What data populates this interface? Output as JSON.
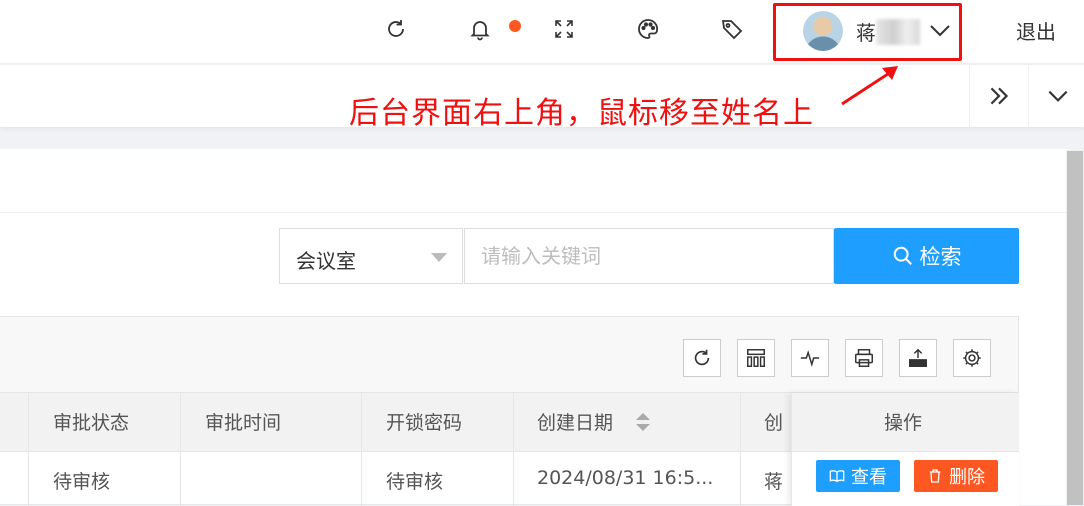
{
  "header": {
    "user_name": "蒋",
    "logout_label": "退出"
  },
  "annotation": {
    "text": "后台界面右上角，鼠标移至姓名上"
  },
  "search": {
    "category_value": "会议室",
    "placeholder": "请输入关键词",
    "button_label": "检索"
  },
  "table": {
    "columns": [
      "审批状态",
      "审批时间",
      "开锁密码",
      "创建日期",
      "创"
    ],
    "actions_header": "操作",
    "rows": [
      {
        "approval_status": "待审核",
        "approval_time": "",
        "unlock_password": "待审核",
        "created_date": "2024/08/31 16:5...",
        "creator": "蒋"
      }
    ],
    "view_label": "查看",
    "delete_label": "删除"
  },
  "colors": {
    "accent_blue": "#1e9fff",
    "danger_orange": "#ff5722",
    "annotation_red": "#f01010"
  }
}
